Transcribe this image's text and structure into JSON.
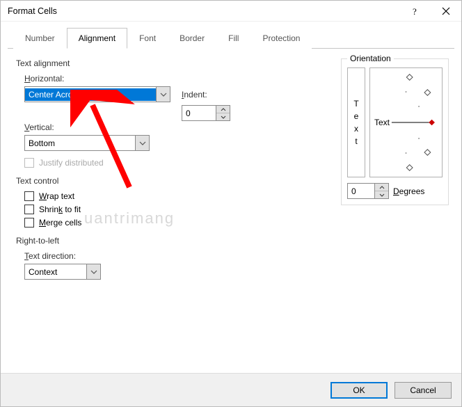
{
  "window": {
    "title": "Format Cells"
  },
  "tabs": [
    "Number",
    "Alignment",
    "Font",
    "Border",
    "Fill",
    "Protection"
  ],
  "alignment": {
    "section": "Text alignment",
    "horizontal_label": "Horizontal:",
    "horizontal_value": "Center Across Selection",
    "indent_label": "Indent:",
    "indent_value": "0",
    "vertical_label": "Vertical:",
    "vertical_value": "Bottom",
    "justify_distributed": "Justify distributed"
  },
  "textcontrol": {
    "section": "Text control",
    "wrap": "Wrap text",
    "shrink": "Shrink to fit",
    "merge": "Merge cells"
  },
  "rtl": {
    "section": "Right-to-left",
    "direction_label": "Text direction:",
    "direction_value": "Context"
  },
  "orientation": {
    "section": "Orientation",
    "vertical_text": "Text",
    "dial_label": "Text",
    "degrees_value": "0",
    "degrees_label": "Degrees"
  },
  "buttons": {
    "ok": "OK",
    "cancel": "Cancel"
  },
  "watermark": "uantrimang"
}
